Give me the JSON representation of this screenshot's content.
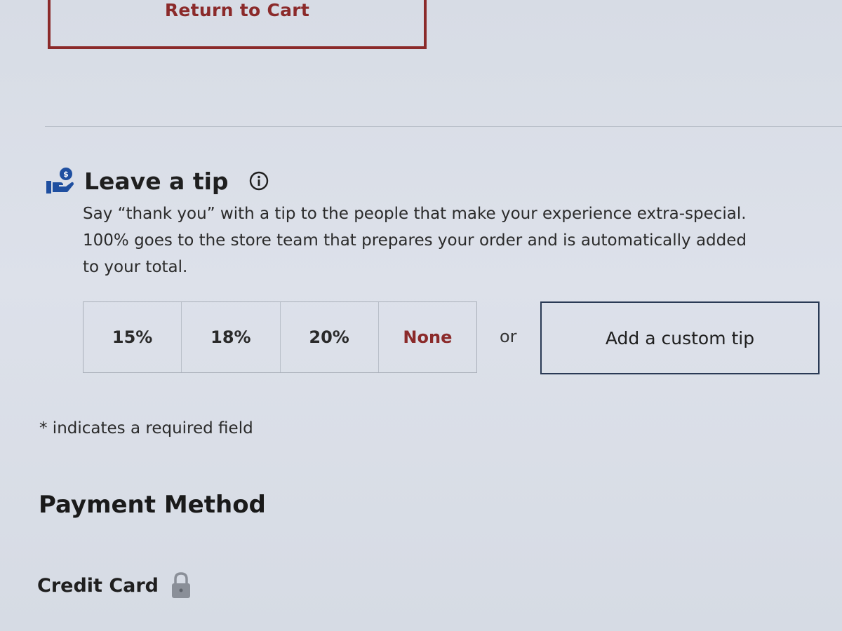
{
  "return_button": {
    "label": "Return to Cart"
  },
  "tip": {
    "title": "Leave a tip",
    "description_lines": [
      "Say “thank you” with a tip to the people that make your experience extra-special.",
      "100% goes to the store team that prepares your order and is automatically added",
      "to your total."
    ],
    "options": [
      "15%",
      "18%",
      "20%",
      "None"
    ],
    "or_label": "or",
    "custom_label": "Add a custom tip"
  },
  "required_note": "* indicates a required field",
  "payment": {
    "title": "Payment Method",
    "credit_card_label": "Credit Card"
  },
  "icons": {
    "tip": "hand-coin-icon",
    "info": "info-icon",
    "lock": "lock-icon"
  },
  "colors": {
    "accent": "#8b2a2a",
    "icon_blue": "#1f4fa0",
    "custom_border": "#2a3a55"
  }
}
